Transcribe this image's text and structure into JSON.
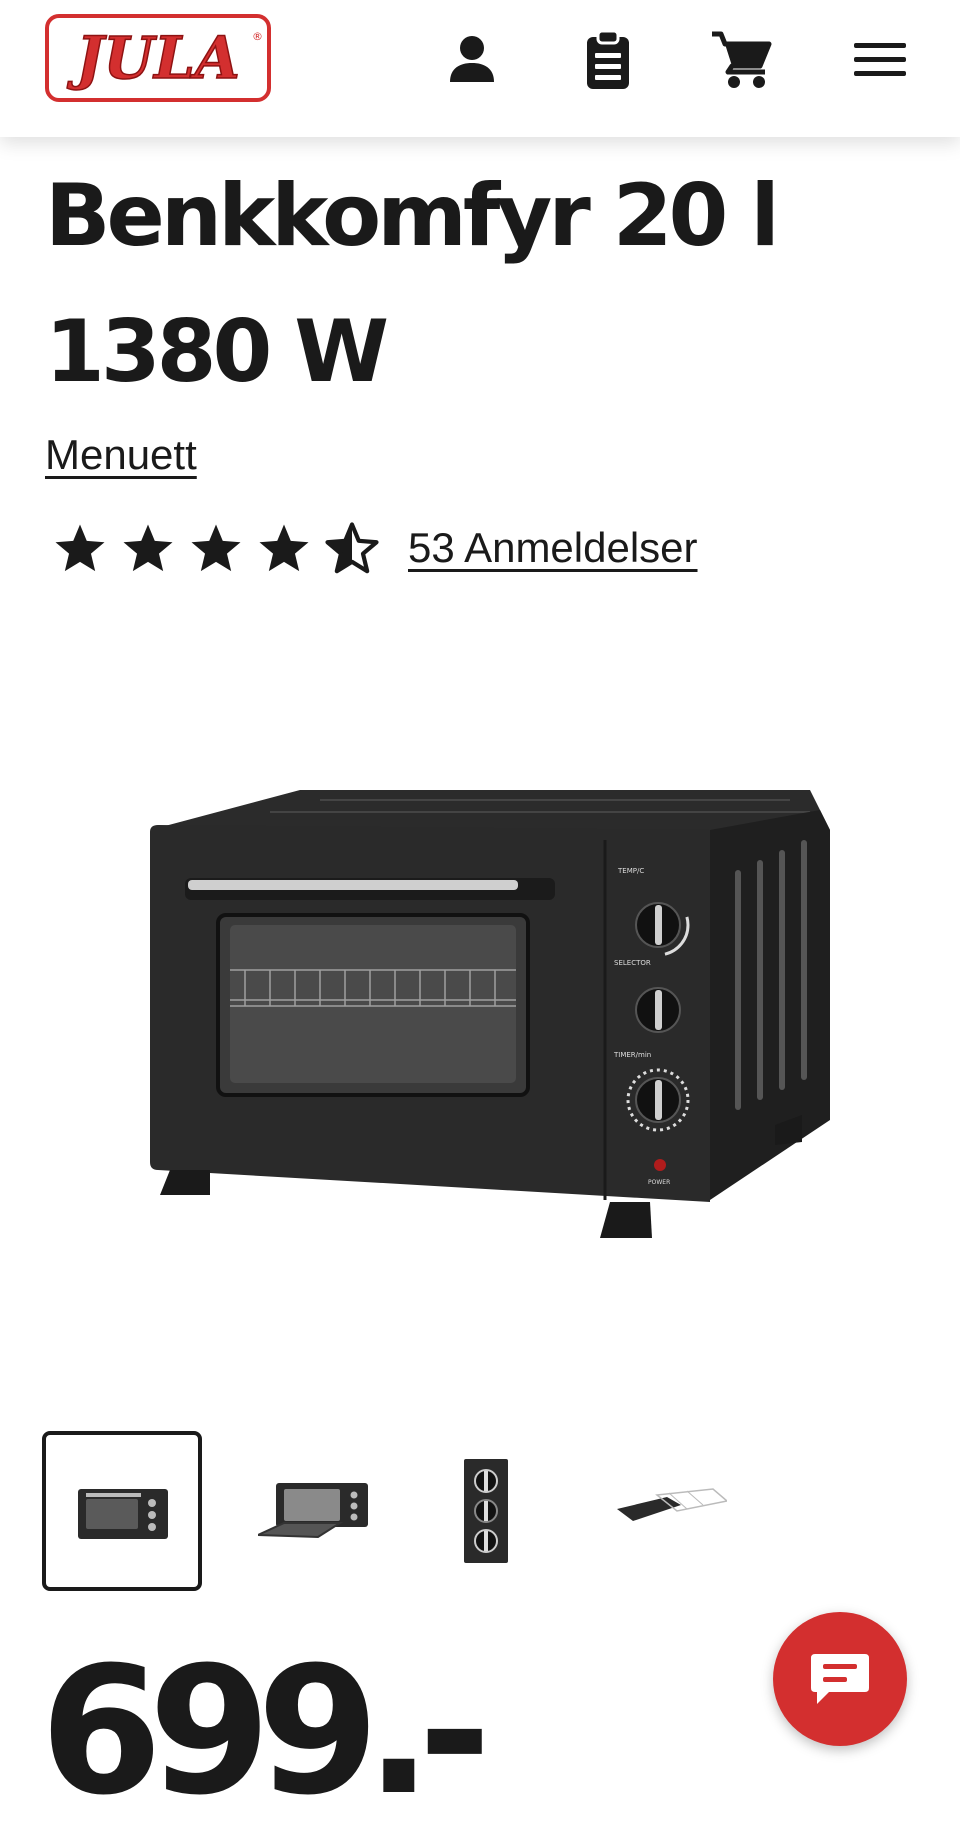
{
  "header": {
    "logo_text": "JULA",
    "logo_mark": "®",
    "icons": [
      "account-icon",
      "clipboard-list-icon",
      "cart-icon",
      "menu-icon"
    ]
  },
  "product": {
    "title": "Benkkomfyr 20 l 1380 W",
    "brand": "Menuett",
    "rating": 4.5,
    "rating_max": 5,
    "reviews_label": "53 Anmeldelser",
    "price": "699.-"
  },
  "gallery": {
    "thumbnail_count": 4,
    "selected_index": 0
  },
  "oven_labels": {
    "temp": "TEMP/C",
    "selector": "SELECTOR",
    "timer": "TIMER/min",
    "power": "POWER"
  },
  "colors": {
    "brand_red": "#d32f2f",
    "text": "#1a1a1a"
  }
}
